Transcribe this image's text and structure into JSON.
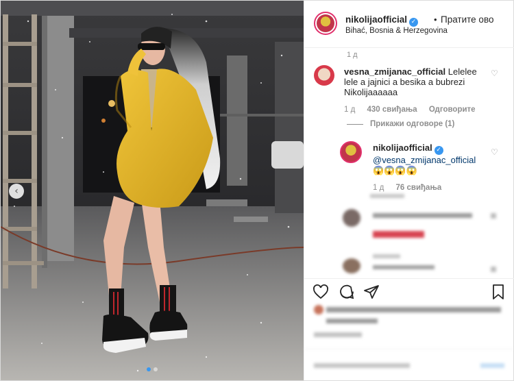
{
  "post": {
    "image_alt": "Woman in yellow fur jacket and black sneakers posing in an unfinished building"
  },
  "header": {
    "username": "nikolijaofficial",
    "verified_icon": "verified-badge-icon",
    "separator": "•",
    "follow_label": "Пратите ово",
    "location": "Bihać, Bosnia & Herzegovina"
  },
  "comments": {
    "caption_time": "1 д",
    "items": [
      {
        "username": "vesna_zmijanac_official",
        "text": "Lelelee lele a jajnici a besika a bubrezi Nikolijaaaaaa",
        "time": "1 д",
        "likes": "430 свиђања",
        "reply_label": "Одговорите"
      },
      {
        "username": "nikolijaofficial",
        "mention": "@vesna_zmijanac_official",
        "emoji": "😱😱😱😱",
        "time": "1 д",
        "likes": "76 свиђања"
      }
    ],
    "view_replies_label": "Прикажи одговоре (1)"
  },
  "icons": {
    "like": "heart-icon",
    "comment": "comment-icon",
    "share": "paper-plane-icon",
    "save": "bookmark-icon",
    "photo_prev": "chevron-left-icon"
  },
  "colors": {
    "accent": "#3897f0",
    "text": "#262626",
    "muted": "#8e8e8e",
    "jacket": "#e2b52a"
  }
}
